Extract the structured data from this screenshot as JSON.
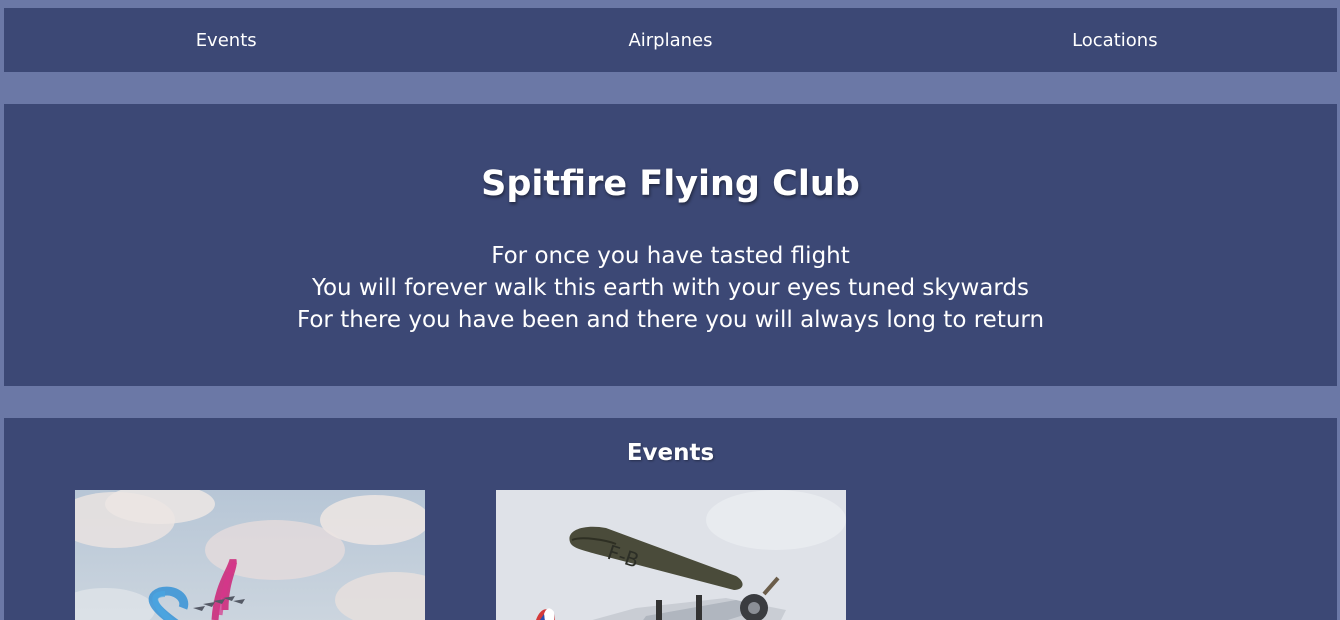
{
  "nav": {
    "items": [
      {
        "label": "Events"
      },
      {
        "label": "Airplanes"
      },
      {
        "label": "Locations"
      }
    ]
  },
  "hero": {
    "title": "Spitfire Flying Club",
    "quote_lines": [
      "For once you have tasted flight",
      "You will forever walk this earth with your eyes tuned skywards",
      "For there you have been and there you will always long to return"
    ]
  },
  "events": {
    "heading": "Events",
    "photos": [
      {
        "name": "aerobatic-display-photo"
      },
      {
        "name": "vintage-biplane-photo"
      }
    ]
  },
  "colors": {
    "page_bg": "#6b78a6",
    "panel_bg": "#3c4875",
    "text": "#ffffff"
  }
}
